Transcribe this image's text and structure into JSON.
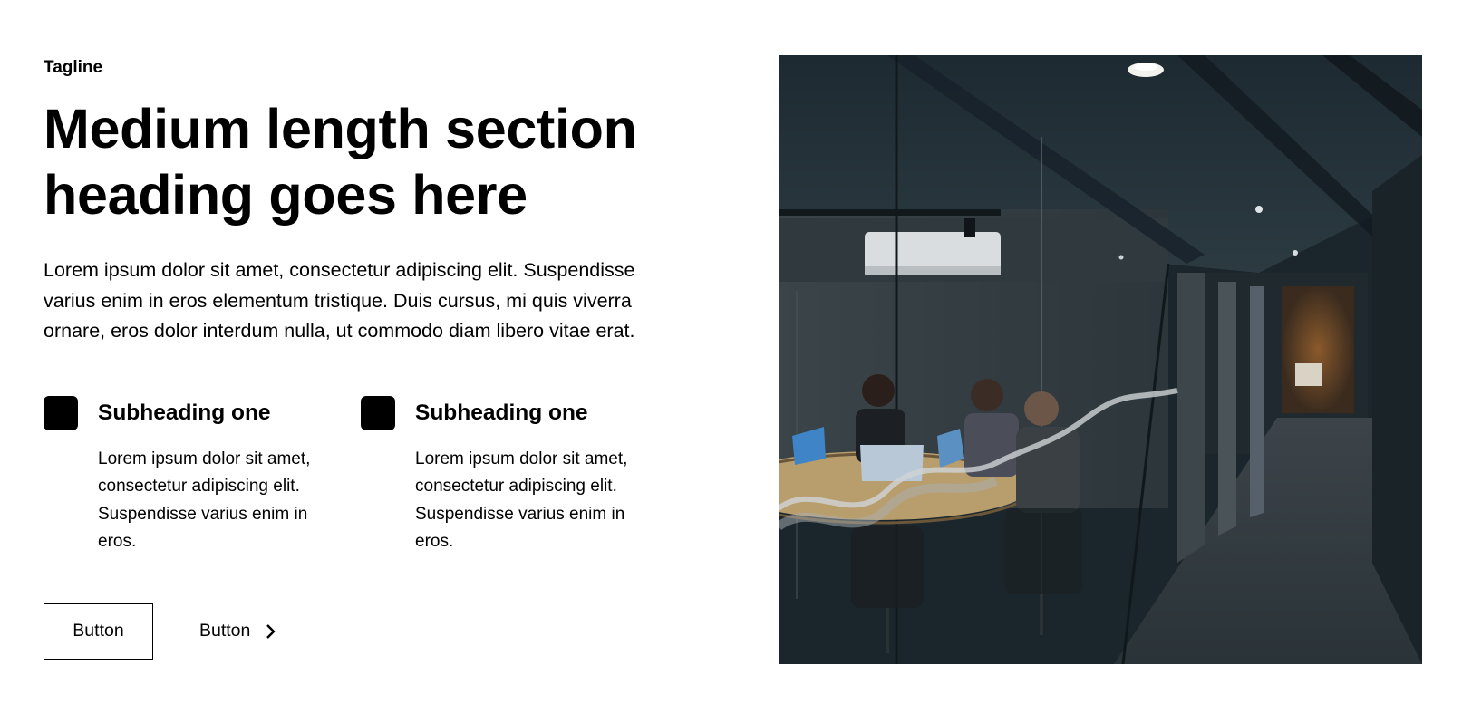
{
  "tagline": "Tagline",
  "heading": "Medium length section heading goes here",
  "lead": "Lorem ipsum dolor sit amet, consectetur adipiscing elit. Suspendisse varius enim in eros elementum tristique. Duis cursus, mi quis viverra ornare, eros dolor interdum nulla, ut commodo diam libero vitae erat.",
  "features": [
    {
      "title": "Subheading one",
      "text": "Lorem ipsum dolor sit amet, consectetur adipiscing elit. Suspendisse varius enim in eros."
    },
    {
      "title": "Subheading one",
      "text": "Lorem ipsum dolor sit amet, consectetur adipiscing elit. Suspendisse varius enim in eros."
    }
  ],
  "buttons": {
    "primary_label": "Button",
    "secondary_label": "Button"
  },
  "image": {
    "alt": "office-meeting-photo"
  },
  "colors": {
    "text": "#000000",
    "background": "#ffffff",
    "icon": "#000000"
  },
  "icons": {
    "feature": "square-icon",
    "link": "chevron-right-icon"
  }
}
